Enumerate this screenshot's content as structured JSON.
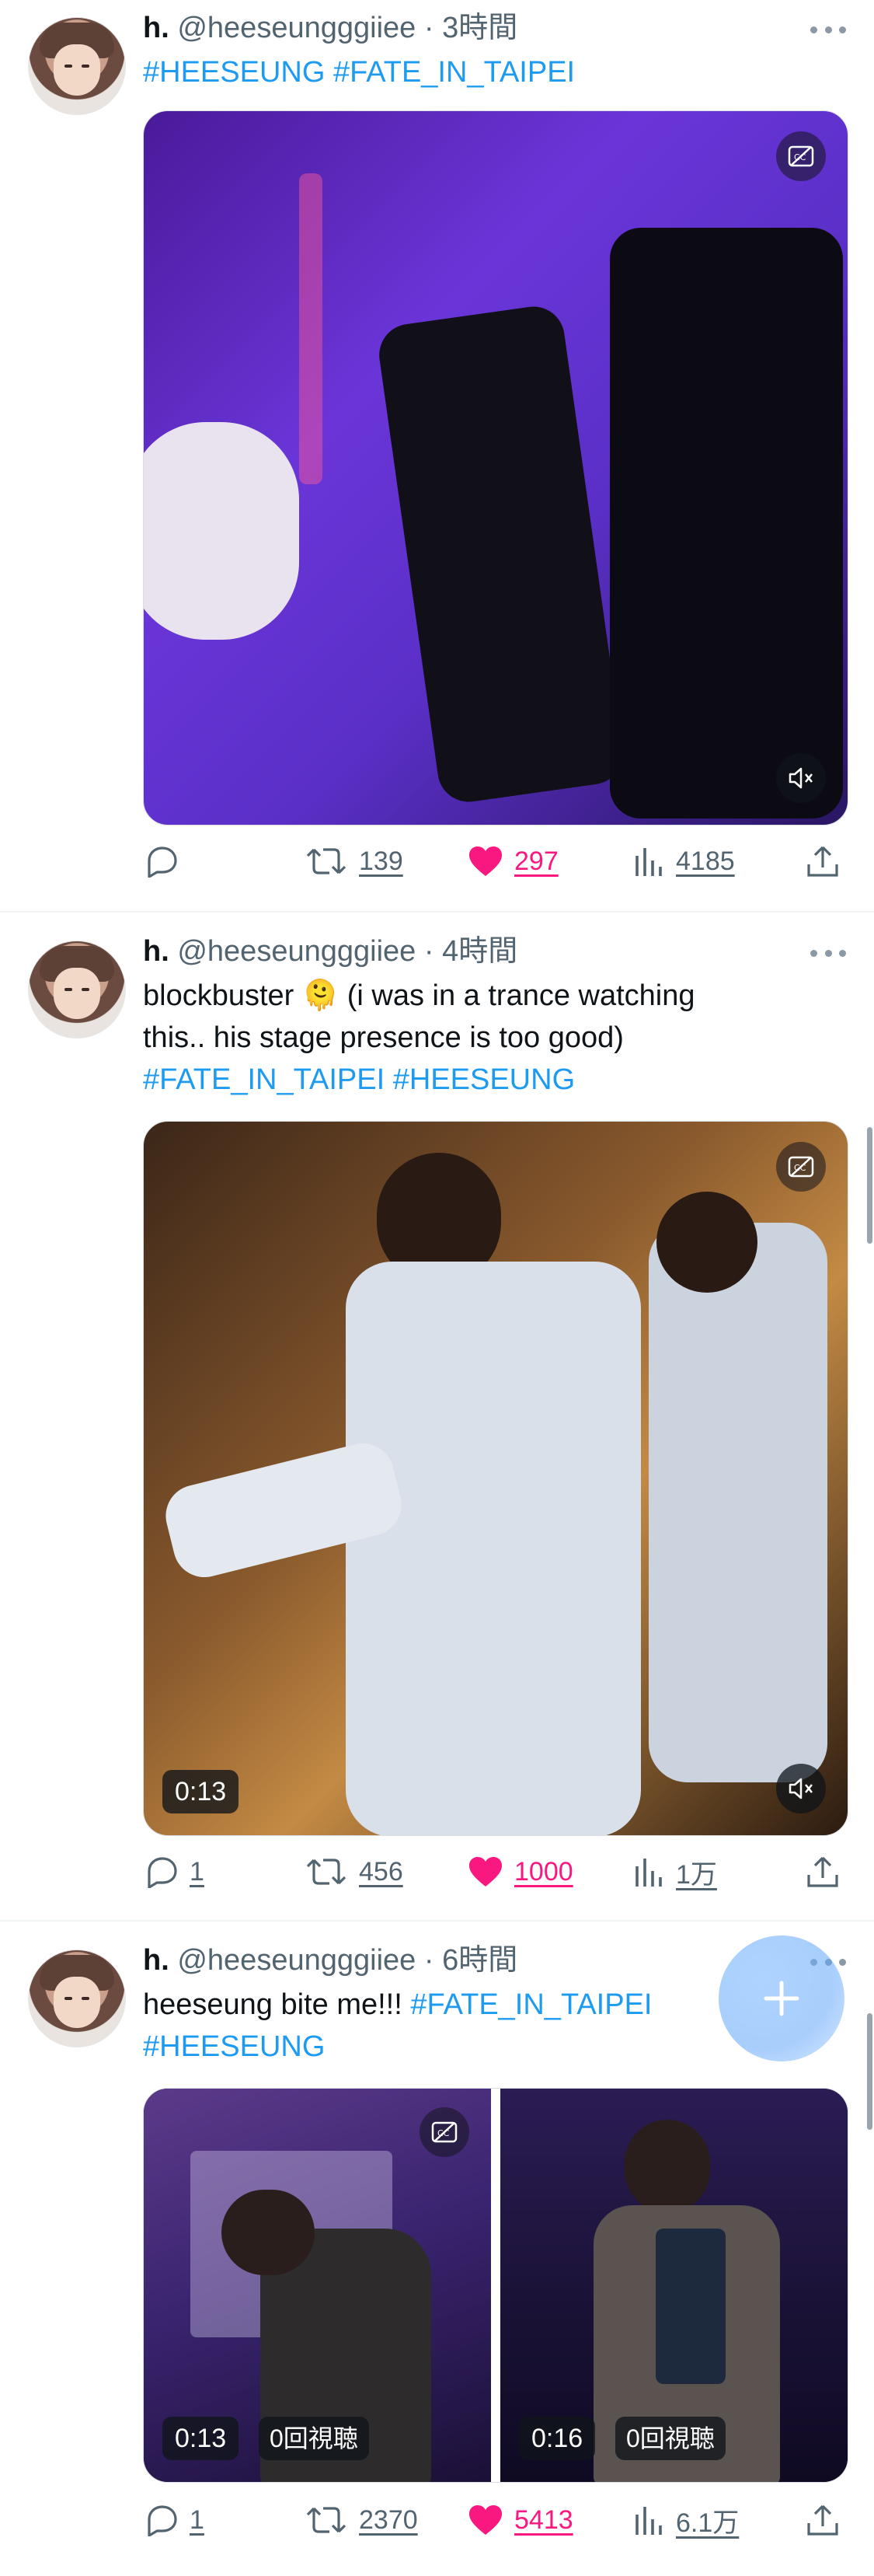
{
  "tweets": [
    {
      "name": "h.",
      "handle": "@heeseungggiiee",
      "dot": "·",
      "time": "3時間",
      "text": [],
      "hashtags": [
        "#HEESEUNG",
        "#FATE_IN_TAIPEI"
      ],
      "media": {
        "type": "video",
        "duration": ""
      },
      "actions": {
        "reply": "",
        "retweet": "139",
        "like": "297",
        "views": "4185"
      }
    },
    {
      "name": "h.",
      "handle": "@heeseungggiiee",
      "dot": "·",
      "time": "4時間",
      "text": [
        "blockbuster 🫠 (i was in a trance watching",
        "this.. his stage presence is too good)"
      ],
      "hashtags": [
        "#FATE_IN_TAIPEI",
        "#HEESEUNG"
      ],
      "media": {
        "type": "video",
        "duration": "0:13"
      },
      "actions": {
        "reply": "1",
        "retweet": "456",
        "like": "1000",
        "views": "1万"
      }
    },
    {
      "name": "h.",
      "handle": "@heeseungggiiee",
      "dot": "·",
      "time": "6時間",
      "text": [
        "heeseung bite me!!!"
      ],
      "hashtags": [
        "#FATE_IN_TAIPEI",
        "#HEESEUNG"
      ],
      "media": [
        {
          "type": "video",
          "duration": "0:13",
          "views": "0回視聴"
        },
        {
          "type": "video",
          "duration": "0:16",
          "views": "0回視聴"
        }
      ],
      "actions": {
        "reply": "1",
        "retweet": "2370",
        "like": "5413",
        "views": "6.1万"
      }
    }
  ],
  "icons": {
    "reply": "reply-icon",
    "retweet": "retweet-icon",
    "like": "heart-icon",
    "views": "views-icon",
    "share": "share-icon",
    "captions": "captions-icon",
    "mute": "mute-icon",
    "compose": "compose-plus-icon",
    "more": "more-icon"
  },
  "colors": {
    "hashtag": "#1d9bf0",
    "like": "#f91880",
    "muted": "#536471"
  }
}
